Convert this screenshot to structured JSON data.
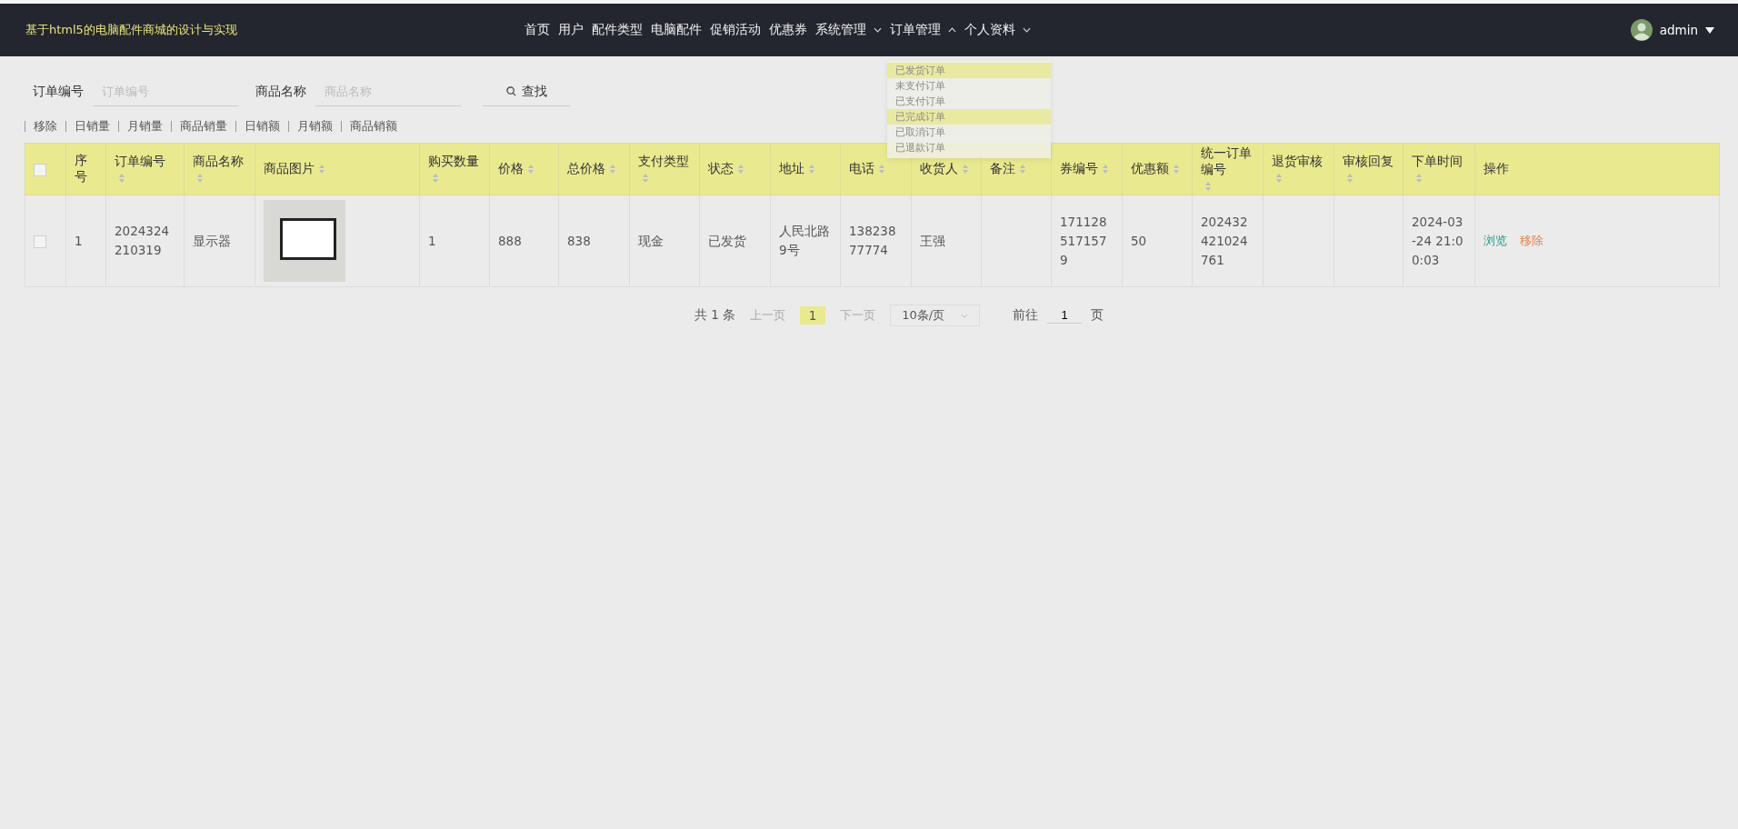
{
  "header": {
    "title": "基于html5的电脑配件商城的设计与实现",
    "nav": [
      {
        "label": "首页",
        "kind": "link"
      },
      {
        "label": "用户",
        "kind": "link"
      },
      {
        "label": "配件类型",
        "kind": "link"
      },
      {
        "label": "电脑配件",
        "kind": "link"
      },
      {
        "label": "促销活动",
        "kind": "link"
      },
      {
        "label": "优惠券",
        "kind": "link"
      },
      {
        "label": "系统管理",
        "kind": "menu",
        "expanded": false
      },
      {
        "label": "订单管理",
        "kind": "menu",
        "expanded": true,
        "items": [
          {
            "label": "已发货订单",
            "selected": true
          },
          {
            "label": "未支付订单",
            "selected": false
          },
          {
            "label": "已支付订单",
            "selected": false
          },
          {
            "label": "已完成订单",
            "selected": true
          },
          {
            "label": "已取消订单",
            "selected": false
          },
          {
            "label": "已退款订单",
            "selected": false
          }
        ]
      },
      {
        "label": "个人资料",
        "kind": "menu",
        "expanded": false
      }
    ],
    "user": "admin"
  },
  "search": {
    "fields": [
      {
        "label": "订单编号",
        "placeholder": "订单编号"
      },
      {
        "label": "商品名称",
        "placeholder": "商品名称"
      }
    ],
    "button": "查找"
  },
  "actions": [
    "移除",
    "日销量",
    "月销量",
    "商品销量",
    "日销额",
    "月销额",
    "商品销额"
  ],
  "table": {
    "all_checked": false,
    "columns": [
      {
        "label": "序号",
        "sortable": false
      },
      {
        "label": "订单编号",
        "sortable": true
      },
      {
        "label": "商品名称",
        "sortable": true
      },
      {
        "label": "商品图片",
        "sortable": true
      },
      {
        "label": "购买数量",
        "sortable": true
      },
      {
        "label": "价格",
        "sortable": true
      },
      {
        "label": "总价格",
        "sortable": true
      },
      {
        "label": "支付类型",
        "sortable": true
      },
      {
        "label": "状态",
        "sortable": true
      },
      {
        "label": "地址",
        "sortable": true
      },
      {
        "label": "电话",
        "sortable": true
      },
      {
        "label": "收货人",
        "sortable": true
      },
      {
        "label": "备注",
        "sortable": true
      },
      {
        "label": "券编号",
        "sortable": true
      },
      {
        "label": "优惠额",
        "sortable": true
      },
      {
        "label": "统一订单编号",
        "sortable": true
      },
      {
        "label": "退货审核",
        "sortable": true
      },
      {
        "label": "审核回复",
        "sortable": true
      },
      {
        "label": "下单时间",
        "sortable": true
      },
      {
        "label": "操作",
        "sortable": false
      }
    ],
    "rows": [
      {
        "checked": false,
        "cells": [
          "1",
          "2024324210319",
          "显示器",
          "",
          "1",
          "888",
          "838",
          "现金",
          "已发货",
          "人民北路9号",
          "13823877774",
          "王强",
          "",
          "1711285171579",
          "50",
          "202432421024761",
          "",
          "",
          "2024-03-24 21:00:03"
        ],
        "ops": [
          "浏览",
          "移除"
        ]
      }
    ]
  },
  "pagination": {
    "total": "共 1 条",
    "prev": "上一页",
    "pages": [
      {
        "label": "1",
        "selected": true
      }
    ],
    "next": "下一页",
    "size": "10条/页",
    "goto": "前往",
    "goto_value": "1",
    "unit": "页"
  }
}
